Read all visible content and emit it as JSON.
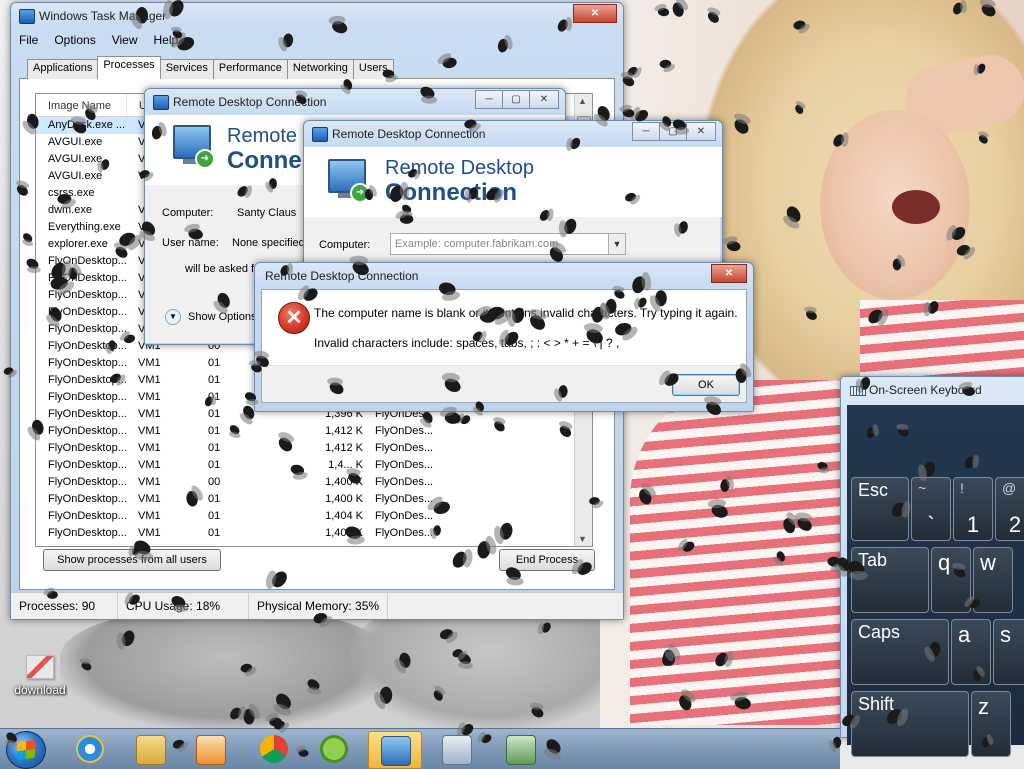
{
  "desktop": {
    "icon_label": "download"
  },
  "taskmgr": {
    "title": "Windows Task Manager",
    "menu": [
      "File",
      "Options",
      "View",
      "Help"
    ],
    "tabs": [
      "Applications",
      "Processes",
      "Services",
      "Performance",
      "Networking",
      "Users"
    ],
    "active_tab": "Processes",
    "columns": [
      "Image Name",
      "U"
    ],
    "processes": [
      {
        "name": "AnyDesk.exe ...",
        "user": "V",
        "cpu": "",
        "mem": "",
        "desc": ""
      },
      {
        "name": "AVGUI.exe",
        "user": "V",
        "cpu": "",
        "mem": "",
        "desc": ""
      },
      {
        "name": "AVGUI.exe",
        "user": "V",
        "cpu": "",
        "mem": "",
        "desc": ""
      },
      {
        "name": "AVGUI.exe",
        "user": "V",
        "cpu": "",
        "mem": "",
        "desc": ""
      },
      {
        "name": "csrss.exe",
        "user": "",
        "cpu": "",
        "mem": "",
        "desc": ""
      },
      {
        "name": "dwm.exe",
        "user": "V",
        "cpu": "",
        "mem": "",
        "desc": ""
      },
      {
        "name": "Everything.exe",
        "user": "V",
        "cpu": "",
        "mem": "",
        "desc": ""
      },
      {
        "name": "explorer.exe",
        "user": "V",
        "cpu": "",
        "mem": "",
        "desc": ""
      },
      {
        "name": "FlyOnDesktop...",
        "user": "V",
        "cpu": "",
        "mem": "",
        "desc": ""
      },
      {
        "name": "FlyOnDesktop...",
        "user": "V",
        "cpu": "",
        "mem": "",
        "desc": ""
      },
      {
        "name": "FlyOnDesktop...",
        "user": "V",
        "cpu": "",
        "mem": "",
        "desc": ""
      },
      {
        "name": "FlyOnDesktop...",
        "user": "V",
        "cpu": "",
        "mem": "",
        "desc": ""
      },
      {
        "name": "FlyOnDesktop...",
        "user": "V",
        "cpu": "",
        "mem": "",
        "desc": ""
      },
      {
        "name": "FlyOnDesktop...",
        "user": "VM1",
        "cpu": "00",
        "mem": "",
        "desc": ""
      },
      {
        "name": "FlyOnDesktop...",
        "user": "VM1",
        "cpu": "01",
        "mem": "",
        "desc": ""
      },
      {
        "name": "FlyOnDesktop...",
        "user": "VM1",
        "cpu": "01",
        "mem": "",
        "desc": ""
      },
      {
        "name": "FlyOnDesktop...",
        "user": "VM1",
        "cpu": "01",
        "mem": "",
        "desc": ""
      },
      {
        "name": "FlyOnDesktop...",
        "user": "VM1",
        "cpu": "01",
        "mem": "1,396 K",
        "desc": "FlyOnDes..."
      },
      {
        "name": "FlyOnDesktop...",
        "user": "VM1",
        "cpu": "01",
        "mem": "1,412 K",
        "desc": "FlyOnDes..."
      },
      {
        "name": "FlyOnDesktop...",
        "user": "VM1",
        "cpu": "01",
        "mem": "1,412 K",
        "desc": "FlyOnDes..."
      },
      {
        "name": "FlyOnDesktop...",
        "user": "VM1",
        "cpu": "01",
        "mem": "1,4... K",
        "desc": "FlyOnDes..."
      },
      {
        "name": "FlyOnDesktop...",
        "user": "VM1",
        "cpu": "00",
        "mem": "1,400 K",
        "desc": "FlyOnDes..."
      },
      {
        "name": "FlyOnDesktop...",
        "user": "VM1",
        "cpu": "01",
        "mem": "1,400 K",
        "desc": "FlyOnDes..."
      },
      {
        "name": "FlyOnDesktop...",
        "user": "VM1",
        "cpu": "01",
        "mem": "1,404 K",
        "desc": "FlyOnDes..."
      },
      {
        "name": "FlyOnDesktop...",
        "user": "VM1",
        "cpu": "01",
        "mem": "1,404 K",
        "desc": "FlyOnDes..."
      }
    ],
    "show_all_label": "Show processes from all users",
    "end_process_label": "End Process",
    "status": {
      "processes": "Processes: 90",
      "cpu": "CPU Usage: 18%",
      "memory": "Physical Memory: 35%"
    }
  },
  "rdc1": {
    "title": "Remote Desktop Connection",
    "heading1": "Remote",
    "heading2": "Conne",
    "computer_label": "Computer:",
    "computer_value": "Santy Claus",
    "username_label": "User name:",
    "username_value": "None specified",
    "asked_text": "will be asked fo",
    "options_label": "Show Options"
  },
  "rdc2": {
    "title": "Remote Desktop Connection",
    "heading1": "Remote Desktop",
    "heading2": "Connection",
    "computer_label": "Computer:",
    "computer_placeholder": "Example: computer.fabrikam.com"
  },
  "error": {
    "title": "Remote Desktop Connection",
    "message": "The computer name is blank or it contains invalid characters. Try typing it again.",
    "details": "Invalid characters include: spaces, tabs, ; : < > * + = \\ | ? ,",
    "ok_label": "OK"
  },
  "osk": {
    "title": "On-Screen Keyboard",
    "keys": {
      "esc": "Esc",
      "tilde_top": "~",
      "tilde_bot": "`",
      "one_top": "!",
      "one_bot": "1",
      "two_top": "@",
      "two_bot": "2",
      "tab": "Tab",
      "q": "q",
      "w": "w",
      "caps": "Caps",
      "a": "a",
      "s": "s",
      "shift": "Shift",
      "z": "z"
    }
  },
  "taskbar": {
    "items": [
      "internet-explorer-icon",
      "file-explorer-icon",
      "media-player-icon",
      "chrome-icon",
      "utorrent-icon",
      "remote-desktop-icon",
      "network-icon",
      "keyboard-app-icon"
    ]
  }
}
